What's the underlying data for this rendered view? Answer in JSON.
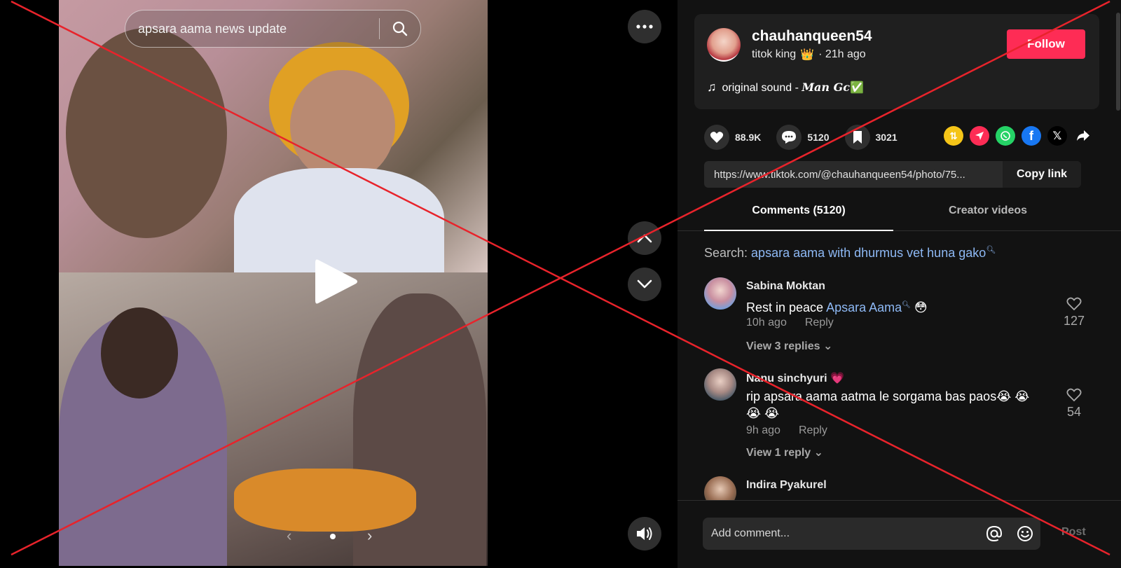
{
  "video": {
    "search_query": "apsara aama news update",
    "carousel_prev": "‹",
    "carousel_next": "›"
  },
  "author": {
    "username": "chauhanqueen54",
    "nickname": "titok king",
    "crown": "👑",
    "posted": "· 21h ago",
    "follow_label": "Follow",
    "sound_prefix": "original sound - ",
    "sound_artist": "𝑴𝒂𝒏 𝑮𝒄",
    "sound_badge": "✅"
  },
  "stats": {
    "likes": "88.9K",
    "comments": "5120",
    "saves": "3021"
  },
  "share": {
    "link": "https://www.tiktok.com/@chauhanqueen54/photo/75...",
    "copy_label": "Copy link"
  },
  "tabs": {
    "comments": "Comments (5120)",
    "creator": "Creator videos"
  },
  "suggest": {
    "prefix": "Search: ",
    "query": "apsara aama with dhurmus vet huna gako"
  },
  "comments": [
    {
      "user": "Sabina Moktan",
      "text_prefix": "Rest in peace ",
      "text_link": "Apsara Aama",
      "text_suffix": " 😳",
      "time": "10h ago",
      "reply": "Reply",
      "replies": "View 3 replies",
      "likes": "127"
    },
    {
      "user": "Nanu sinchyuri 💗",
      "text": "rip apsara aama aatma le sorgama bas paos😭 😭 😭 😭",
      "time": "9h ago",
      "reply": "Reply",
      "replies": "View 1 reply",
      "likes": "54"
    },
    {
      "user": "Indira Pyakurel"
    }
  ],
  "composer": {
    "placeholder": "Add comment...",
    "post_label": "Post"
  },
  "colors": {
    "follow": "#fe2c55",
    "link": "#8eb9f5",
    "overlay_x": "#e8232b"
  }
}
